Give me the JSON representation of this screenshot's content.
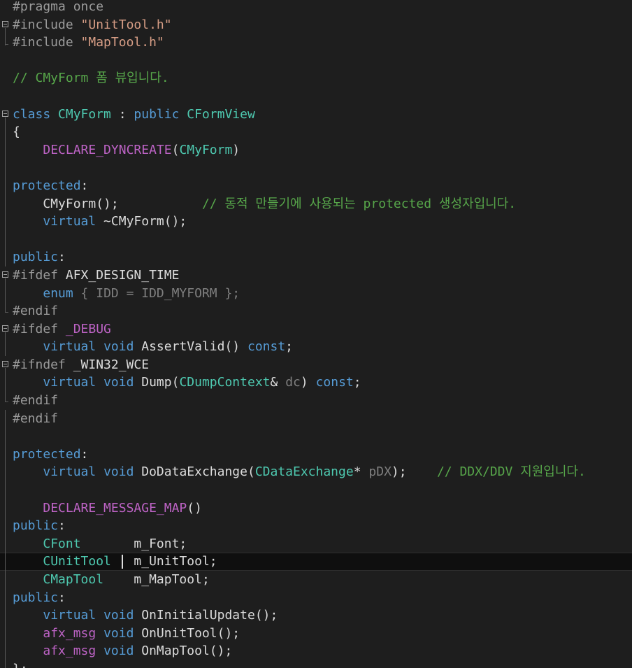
{
  "editor": {
    "theme": "dark",
    "colors": {
      "background": "#1e1e1e",
      "keyword": "#569cd6",
      "class": "#4ec9b0",
      "macro": "#bd63c5",
      "string": "#d69d85",
      "comment": "#57a64a",
      "preprocessor": "#9b9b9b",
      "text": "#dcdcdc"
    },
    "current_line": 31,
    "lines": [
      {
        "fold": null,
        "guide": "none",
        "tokens": [
          {
            "t": "#pragma once",
            "c": "pp"
          }
        ]
      },
      {
        "fold": "collapse",
        "guide": "none",
        "tokens": [
          {
            "t": "#include ",
            "c": "pp"
          },
          {
            "t": "\"UnitTool.h\"",
            "c": "str"
          }
        ]
      },
      {
        "fold": null,
        "guide": "end",
        "tokens": [
          {
            "t": "#include ",
            "c": "pp"
          },
          {
            "t": "\"MapTool.h\"",
            "c": "str"
          }
        ]
      },
      {
        "fold": null,
        "guide": "none",
        "tokens": []
      },
      {
        "fold": null,
        "guide": "none",
        "tokens": [
          {
            "t": "// CMyForm 폼 뷰입니다.",
            "c": "cmt"
          }
        ]
      },
      {
        "fold": null,
        "guide": "none",
        "tokens": []
      },
      {
        "fold": "collapse",
        "guide": "none",
        "tokens": [
          {
            "t": "class ",
            "c": "kw"
          },
          {
            "t": "CMyForm",
            "c": "cls"
          },
          {
            "t": " : ",
            "c": "plain"
          },
          {
            "t": "public ",
            "c": "kw"
          },
          {
            "t": "CFormView",
            "c": "cls"
          }
        ]
      },
      {
        "fold": null,
        "guide": "line",
        "tokens": [
          {
            "t": "{",
            "c": "plain"
          }
        ]
      },
      {
        "fold": null,
        "guide": "line",
        "tokens": [
          {
            "t": "    ",
            "c": "plain"
          },
          {
            "t": "DECLARE_DYNCREATE",
            "c": "mac"
          },
          {
            "t": "(",
            "c": "plain"
          },
          {
            "t": "CMyForm",
            "c": "cls"
          },
          {
            "t": ")",
            "c": "plain"
          }
        ]
      },
      {
        "fold": null,
        "guide": "line",
        "tokens": []
      },
      {
        "fold": null,
        "guide": "line",
        "tokens": [
          {
            "t": "protected",
            "c": "kw"
          },
          {
            "t": ":",
            "c": "plain"
          }
        ]
      },
      {
        "fold": null,
        "guide": "line",
        "tokens": [
          {
            "t": "    CMyForm();           ",
            "c": "plain"
          },
          {
            "t": "// 동적 만들기에 사용되는 protected 생성자입니다.",
            "c": "cmt"
          }
        ]
      },
      {
        "fold": null,
        "guide": "line",
        "tokens": [
          {
            "t": "    ",
            "c": "plain"
          },
          {
            "t": "virtual",
            "c": "kw"
          },
          {
            "t": " ~CMyForm();",
            "c": "plain"
          }
        ]
      },
      {
        "fold": null,
        "guide": "line",
        "tokens": []
      },
      {
        "fold": null,
        "guide": "line",
        "tokens": [
          {
            "t": "public",
            "c": "kw"
          },
          {
            "t": ":",
            "c": "plain"
          }
        ]
      },
      {
        "fold": "collapse",
        "guide": "none",
        "tokens": [
          {
            "t": "#ifdef ",
            "c": "pp"
          },
          {
            "t": "AFX_DESIGN_TIME",
            "c": "plain"
          }
        ]
      },
      {
        "fold": null,
        "guide": "line",
        "tokens": [
          {
            "t": "    ",
            "c": "plain"
          },
          {
            "t": "enum",
            "c": "kw"
          },
          {
            "t": " { IDD = IDD_MYFORM };",
            "c": "dim"
          }
        ]
      },
      {
        "fold": null,
        "guide": "end",
        "tokens": [
          {
            "t": "#endif",
            "c": "pp"
          }
        ]
      },
      {
        "fold": "collapse",
        "guide": "none",
        "tokens": [
          {
            "t": "#ifdef ",
            "c": "pp"
          },
          {
            "t": "_DEBUG",
            "c": "mac"
          }
        ]
      },
      {
        "fold": null,
        "guide": "line",
        "tokens": [
          {
            "t": "    ",
            "c": "plain"
          },
          {
            "t": "virtual",
            "c": "kw"
          },
          {
            "t": " ",
            "c": "plain"
          },
          {
            "t": "void",
            "c": "kw"
          },
          {
            "t": " AssertValid() ",
            "c": "plain"
          },
          {
            "t": "const",
            "c": "kw"
          },
          {
            "t": ";",
            "c": "plain"
          }
        ]
      },
      {
        "fold": "collapse",
        "guide": "none",
        "tokens": [
          {
            "t": "#ifndef ",
            "c": "pp"
          },
          {
            "t": "_WIN32_WCE",
            "c": "plain"
          }
        ]
      },
      {
        "fold": null,
        "guide": "line",
        "tokens": [
          {
            "t": "    ",
            "c": "plain"
          },
          {
            "t": "virtual",
            "c": "kw"
          },
          {
            "t": " ",
            "c": "plain"
          },
          {
            "t": "void",
            "c": "kw"
          },
          {
            "t": " Dump(",
            "c": "plain"
          },
          {
            "t": "CDumpContext",
            "c": "cls"
          },
          {
            "t": "& ",
            "c": "plain"
          },
          {
            "t": "dc",
            "c": "param"
          },
          {
            "t": ") ",
            "c": "plain"
          },
          {
            "t": "const",
            "c": "kw"
          },
          {
            "t": ";",
            "c": "plain"
          }
        ]
      },
      {
        "fold": null,
        "guide": "end",
        "tokens": [
          {
            "t": "#endif",
            "c": "pp"
          }
        ]
      },
      {
        "fold": null,
        "guide": "line",
        "tokens": [
          {
            "t": "#endif",
            "c": "pp"
          }
        ]
      },
      {
        "fold": null,
        "guide": "line",
        "tokens": []
      },
      {
        "fold": null,
        "guide": "line",
        "tokens": [
          {
            "t": "protected",
            "c": "kw"
          },
          {
            "t": ":",
            "c": "plain"
          }
        ]
      },
      {
        "fold": null,
        "guide": "line",
        "tokens": [
          {
            "t": "    ",
            "c": "plain"
          },
          {
            "t": "virtual",
            "c": "kw"
          },
          {
            "t": " ",
            "c": "plain"
          },
          {
            "t": "void",
            "c": "kw"
          },
          {
            "t": " DoDataExchange(",
            "c": "plain"
          },
          {
            "t": "CDataExchange",
            "c": "cls"
          },
          {
            "t": "* ",
            "c": "plain"
          },
          {
            "t": "pDX",
            "c": "param"
          },
          {
            "t": ");    ",
            "c": "plain"
          },
          {
            "t": "// DDX/DDV 지원입니다.",
            "c": "cmt"
          }
        ]
      },
      {
        "fold": null,
        "guide": "line",
        "tokens": []
      },
      {
        "fold": null,
        "guide": "line",
        "tokens": [
          {
            "t": "    ",
            "c": "plain"
          },
          {
            "t": "DECLARE_MESSAGE_MAP",
            "c": "mac"
          },
          {
            "t": "()",
            "c": "plain"
          }
        ]
      },
      {
        "fold": null,
        "guide": "line",
        "tokens": [
          {
            "t": "public",
            "c": "kw"
          },
          {
            "t": ":",
            "c": "plain"
          }
        ]
      },
      {
        "fold": null,
        "guide": "line",
        "tokens": [
          {
            "t": "    ",
            "c": "plain"
          },
          {
            "t": "CFont",
            "c": "cls"
          },
          {
            "t": "       m_Font;",
            "c": "plain"
          }
        ]
      },
      {
        "fold": null,
        "guide": "line",
        "tokens": [
          {
            "t": "    ",
            "c": "plain"
          },
          {
            "t": "CUnitTool",
            "c": "cls"
          },
          {
            "t": "   m_UnitTool;",
            "c": "plain"
          }
        ]
      },
      {
        "fold": null,
        "guide": "line",
        "tokens": [
          {
            "t": "    ",
            "c": "plain"
          },
          {
            "t": "CMapTool",
            "c": "cls"
          },
          {
            "t": "    m_MapTool;",
            "c": "plain"
          }
        ]
      },
      {
        "fold": null,
        "guide": "line",
        "tokens": [
          {
            "t": "public",
            "c": "kw"
          },
          {
            "t": ":",
            "c": "plain"
          }
        ]
      },
      {
        "fold": null,
        "guide": "line",
        "tokens": [
          {
            "t": "    ",
            "c": "plain"
          },
          {
            "t": "virtual",
            "c": "kw"
          },
          {
            "t": " ",
            "c": "plain"
          },
          {
            "t": "void",
            "c": "kw"
          },
          {
            "t": " OnInitialUpdate();",
            "c": "plain"
          }
        ]
      },
      {
        "fold": null,
        "guide": "line",
        "tokens": [
          {
            "t": "    ",
            "c": "plain"
          },
          {
            "t": "afx_msg",
            "c": "mac"
          },
          {
            "t": " ",
            "c": "plain"
          },
          {
            "t": "void",
            "c": "kw"
          },
          {
            "t": " OnUnitTool();",
            "c": "plain"
          }
        ]
      },
      {
        "fold": null,
        "guide": "line",
        "tokens": [
          {
            "t": "    ",
            "c": "plain"
          },
          {
            "t": "afx_msg",
            "c": "mac"
          },
          {
            "t": " ",
            "c": "plain"
          },
          {
            "t": "void",
            "c": "kw"
          },
          {
            "t": " OnMapTool();",
            "c": "plain"
          }
        ]
      },
      {
        "fold": null,
        "guide": "line",
        "tokens": [
          {
            "t": "};",
            "c": "plain"
          }
        ]
      }
    ]
  }
}
